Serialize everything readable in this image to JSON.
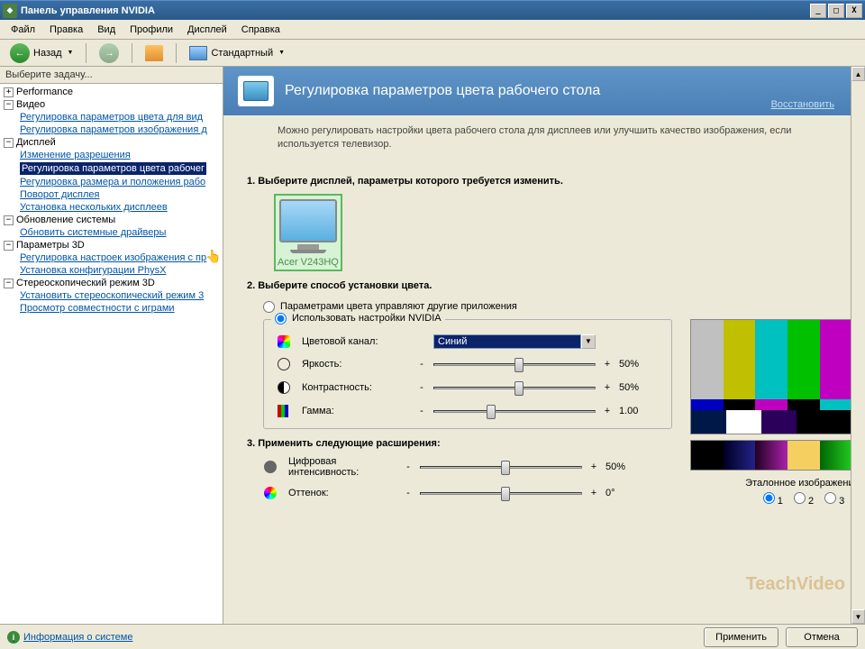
{
  "window": {
    "title": "Панель управления NVIDIA"
  },
  "winbtns": {
    "min": "_",
    "max": "□",
    "close": "X"
  },
  "menu": {
    "file": "Файл",
    "edit": "Правка",
    "view": "Вид",
    "profiles": "Профили",
    "display": "Дисплей",
    "help": "Справка"
  },
  "toolbar": {
    "back": "Назад",
    "dd": "▼",
    "std": "Стандартный",
    "home": ""
  },
  "sidebar": {
    "header": "Выберите задачу...",
    "nodes": {
      "perf": "Performance",
      "video": "Видео",
      "video1": "Регулировка параметров цвета для вид",
      "video2": "Регулировка параметров изображения д",
      "display": "Дисплей",
      "display1": "Изменение разрешения",
      "display2": "Регулировка параметров цвета рабочег",
      "display3": "Регулировка размера и положения рабо",
      "display4": "Поворот дисплея",
      "display5": "Установка нескольких дисплеев",
      "sysupd": "Обновление системы",
      "sysupd1": "Обновить системные драйверы",
      "p3d": "Параметры 3D",
      "p3d1": "Регулировка настроек изображения с пр",
      "p3d2": "Установка конфигурации PhysX",
      "stereo": "Стереоскопический режим 3D",
      "stereo1": "Установить стереоскопический режим 3",
      "stereo2": "Просмотр совместности с играми"
    }
  },
  "banner": {
    "title": "Регулировка параметров цвета рабочего стола",
    "restore": "Восстановить"
  },
  "desc": "Можно регулировать настройки цвета рабочего стола для дисплеев или улучшить качество изображения, если используется телевизор.",
  "sec1": {
    "title": "1. Выберите дисплей, параметры которого требуется изменить.",
    "monitor": "Acer V243HQ"
  },
  "sec2": {
    "title": "2. Выберите способ установки цвета.",
    "opt1": "Параметрами цвета управляют другие приложения",
    "opt2": "Использовать настройки NVIDIA",
    "channel_label": "Цветовой канал:",
    "channel_value": "Синий",
    "brightness_label": "Яркость:",
    "brightness_value": "50%",
    "contrast_label": "Контрастность:",
    "contrast_value": "50%",
    "gamma_label": "Гамма:",
    "gamma_value": "1.00"
  },
  "sec3": {
    "title": "3. Применить следующие расширения:",
    "digital_label": "Цифровая интенсивность:",
    "digital_value": "50%",
    "hue_label": "Оттенок:",
    "hue_value": "0°",
    "ref_label": "Эталонное изображение:",
    "r1": "1",
    "r2": "2",
    "r3": "3"
  },
  "status": {
    "info": "Информация о системе",
    "apply": "Применить",
    "cancel": "Отмена"
  },
  "sym": {
    "minus": "-",
    "plus": "+",
    "expand": "+",
    "collapse": "−",
    "dd": "▼"
  },
  "watermark": "TeachVideo"
}
